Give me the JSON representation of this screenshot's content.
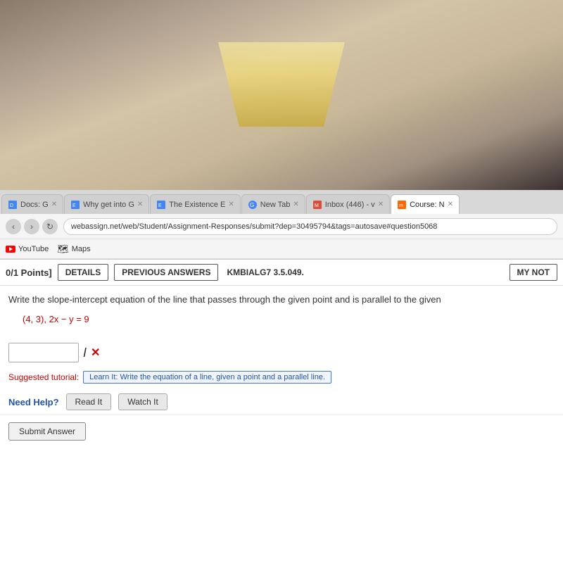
{
  "photo": {
    "alt": "Desk with laptop and lamp background photo"
  },
  "browser": {
    "tabs": [
      {
        "id": "docs-tab",
        "label": "Docs: G",
        "active": false,
        "favicon": "doc"
      },
      {
        "id": "why-get-into-tab",
        "label": "Why get into G",
        "active": false,
        "favicon": "doc"
      },
      {
        "id": "existence-tab",
        "label": "The Existence E",
        "active": false,
        "favicon": "doc"
      },
      {
        "id": "new-tab",
        "label": "New Tab",
        "active": false,
        "favicon": "circle"
      },
      {
        "id": "inbox-tab",
        "label": "Inbox (446) - v",
        "active": false,
        "favicon": "mail"
      },
      {
        "id": "course-tab",
        "label": "Course: N",
        "active": true,
        "favicon": "course"
      }
    ],
    "address": "webassign.net/web/Student/Assignment-Responses/submit?dep=30495794&tags=autosave#question5068",
    "bookmarks": [
      {
        "id": "youtube",
        "label": "YouTube",
        "type": "youtube"
      },
      {
        "id": "maps",
        "label": "Maps",
        "type": "maps"
      }
    ]
  },
  "question": {
    "points_label": "0/1 Points]",
    "details_btn": "DETAILS",
    "previous_answers_btn": "PREVIOUS ANSWERS",
    "question_id": "KMBIALG7 3.5.049.",
    "my_notes_btn": "MY NOT",
    "question_text": "Write the slope-intercept equation of the line that passes through the given point and is parallel to the given",
    "math_expression": "(4, 3), 2x − y = 9",
    "answer_placeholder": "",
    "tutorial_label": "Suggested tutorial:",
    "tutorial_link_text": "Learn It: Write the equation of a line, given a point and a parallel line.",
    "need_help_label": "Need Help?",
    "read_it_btn": "Read It",
    "watch_it_btn": "Watch It",
    "submit_btn": "Submit Answer"
  }
}
